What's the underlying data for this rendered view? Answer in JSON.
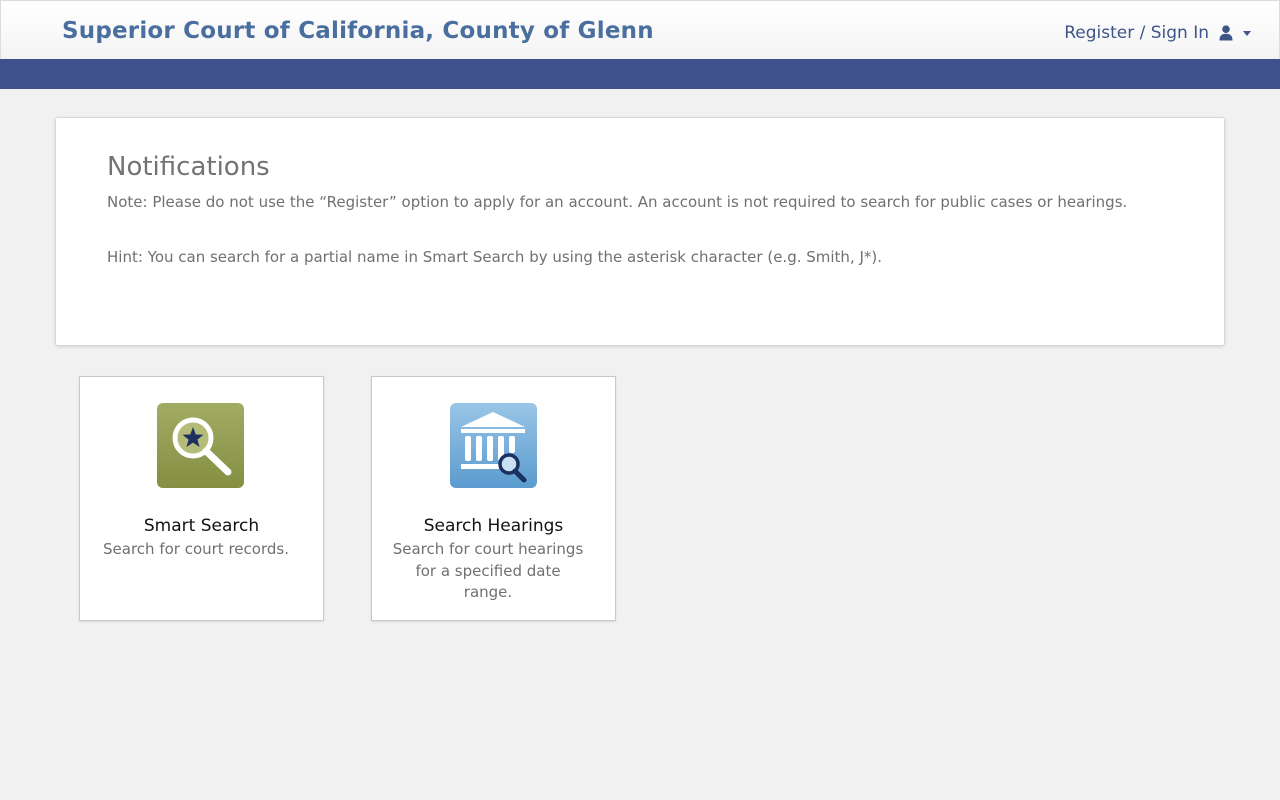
{
  "header": {
    "title": "Superior Court of California, County of Glenn",
    "signin_label": "Register / Sign In",
    "signin_icon": "user-icon",
    "dropdown_icon": "caret-down-icon",
    "accent_color": "#3f508e",
    "title_color": "#4a6f9f"
  },
  "notifications": {
    "title": "Notifications",
    "note": "Note: Please do not use the “Register” option to apply for an account. An account is not required to search for public cases or hearings.",
    "hint": "Hint: You can search for a partial name in Smart Search by using the asterisk character (e.g. Smith, J*)."
  },
  "cards": [
    {
      "title": "Smart Search",
      "description": "Search for court records.",
      "icon": "smart-search-icon",
      "icon_color": "#8f9a4e"
    },
    {
      "title": "Search Hearings",
      "description": "Search for court hearings for a specified date range.",
      "icon": "courthouse-search-icon",
      "icon_color": "#6fa7d4"
    }
  ]
}
